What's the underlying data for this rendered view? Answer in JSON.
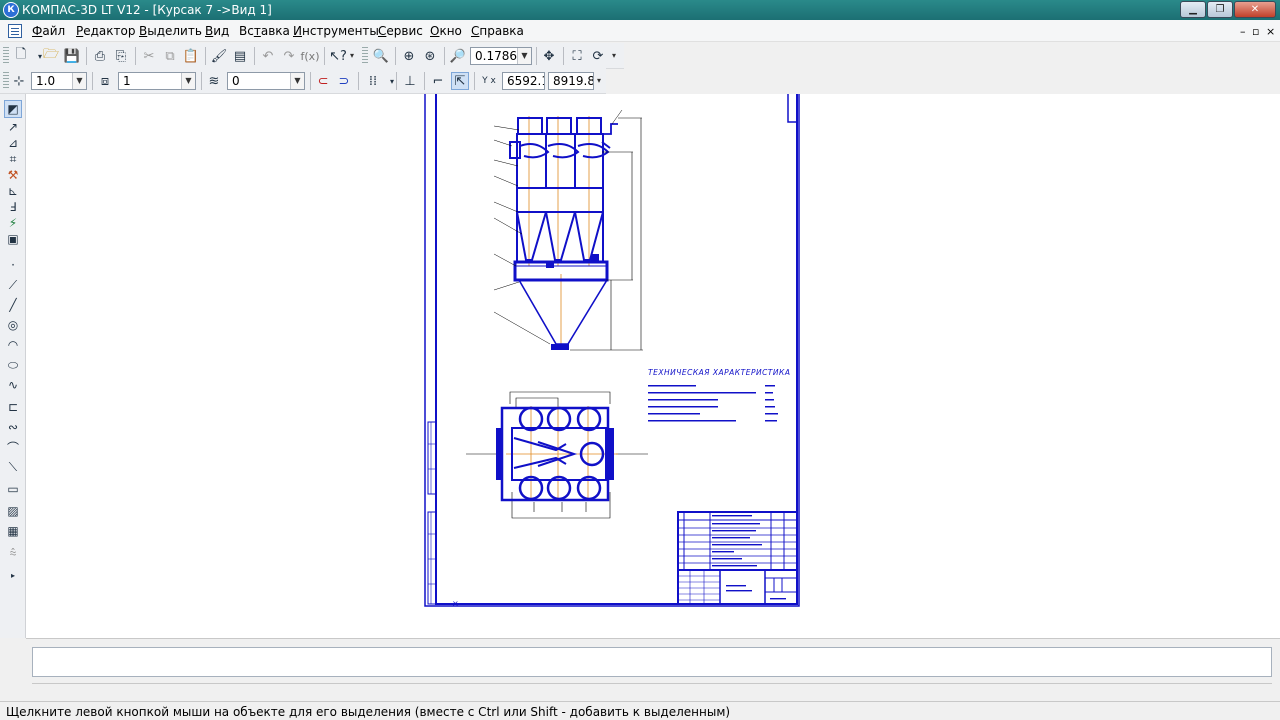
{
  "window": {
    "title": "КОМПАС-3D LT V12 - [Курсак 7 ->Вид 1]",
    "app_icon": "kompas-logo-icon",
    "controls": [
      "minimize-icon",
      "maximize-icon",
      "close-icon"
    ]
  },
  "menu": {
    "items": [
      "Файл",
      "Редактор",
      "Выделить",
      "Вид",
      "Вставка",
      "Инструменты",
      "Сервис",
      "Окно",
      "Справка"
    ],
    "underline": [
      "Ф",
      "Р",
      "В",
      "В",
      "т",
      "И",
      "С",
      "О",
      "С"
    ]
  },
  "toolbar_top": {
    "zoom_value": "0.1786"
  },
  "toolbar_props": {
    "line_scale": "1.0",
    "layer_value": "1",
    "style_value": "0",
    "coord_x": "6592.1",
    "coord_y": "8919.8",
    "coord_label": "Y x"
  },
  "drawing": {
    "tech_title": "ТЕХНИЧЕСКАЯ ХАРАКТЕРИСТИКА",
    "accent_color": "#1010c8",
    "axis_color": "#e08a20"
  },
  "status": {
    "hint": "Щелкните левой кнопкой мыши на объекте для его выделения (вместе с Ctrl или Shift - добавить к выделенным)"
  }
}
